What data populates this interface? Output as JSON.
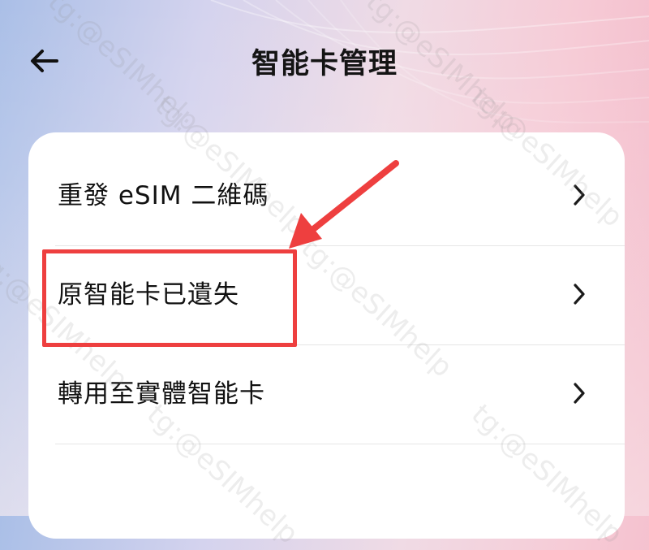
{
  "header": {
    "title": "智能卡管理",
    "back_icon": "arrow-left-icon"
  },
  "menu": {
    "items": [
      {
        "label": "重發 eSIM 二維碼",
        "icon": "chevron-right-icon"
      },
      {
        "label": "原智能卡已遺失",
        "icon": "chevron-right-icon"
      },
      {
        "label": "轉用至實體智能卡",
        "icon": "chevron-right-icon"
      }
    ]
  },
  "watermark": {
    "text": "tg:@eSIMhelp"
  },
  "annotation": {
    "color": "#ee3f3f",
    "highlighted_item": "原智能卡已遺失"
  }
}
